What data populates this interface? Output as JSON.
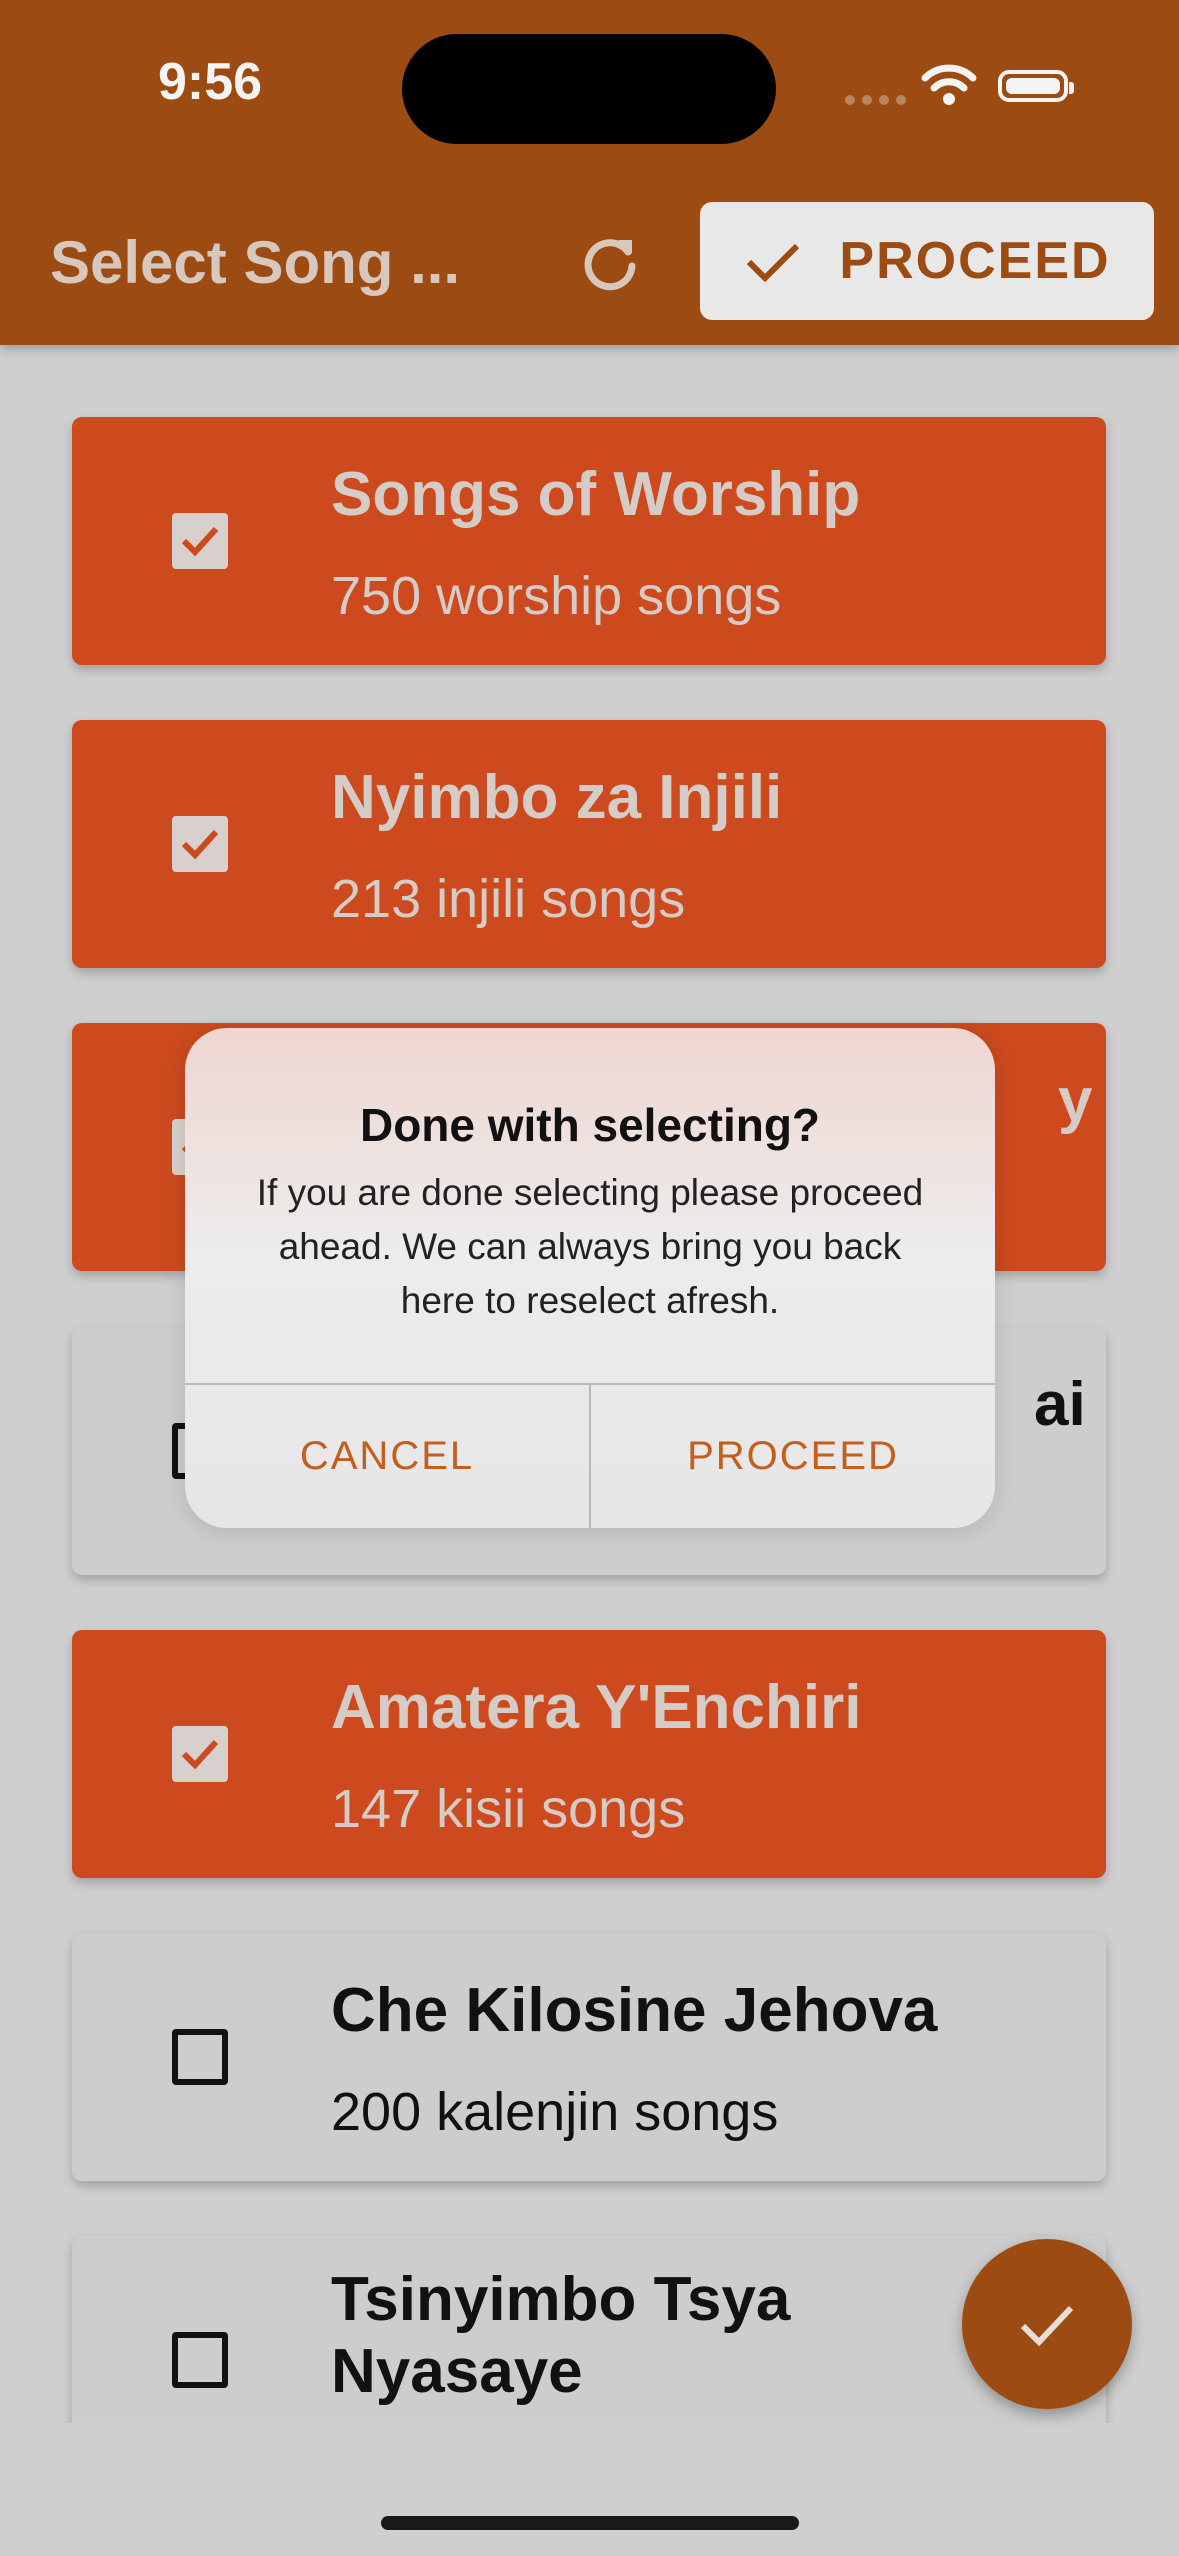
{
  "status_bar": {
    "time": "9:56"
  },
  "app_bar": {
    "title": "Select Song ...",
    "proceed_label": "PROCEED",
    "colors": {
      "bar": "#9c4b12",
      "selected_card": "#cc4a1e"
    }
  },
  "songbooks": [
    {
      "title": "Songs of Worship",
      "subtitle": "750 worship songs",
      "selected": true
    },
    {
      "title": "Nyimbo za Injili",
      "subtitle": "213 injili songs",
      "selected": true
    },
    {
      "title": "",
      "subtitle": "",
      "selected": true
    },
    {
      "title": "",
      "subtitle": "",
      "selected": false
    },
    {
      "title": "Amatera Y'Enchiri",
      "subtitle": "147 kisii songs",
      "selected": true
    },
    {
      "title": "Che Kilosine Jehova",
      "subtitle": "200 kalenjin songs",
      "selected": false
    },
    {
      "title": "Tsinyimbo Tsya Nyasaye",
      "subtitle": "",
      "selected": false
    }
  ],
  "partial_text": {
    "card3_right": "y",
    "card4_right": "ai"
  },
  "dialog": {
    "title": "Done with selecting?",
    "message": "If you are done selecting please proceed ahead. We can always bring you back here to reselect afresh.",
    "cancel_label": "CANCEL",
    "proceed_label": "PROCEED"
  },
  "icons": {
    "refresh": "refresh-icon",
    "check": "check-icon",
    "fab": "check-icon"
  }
}
